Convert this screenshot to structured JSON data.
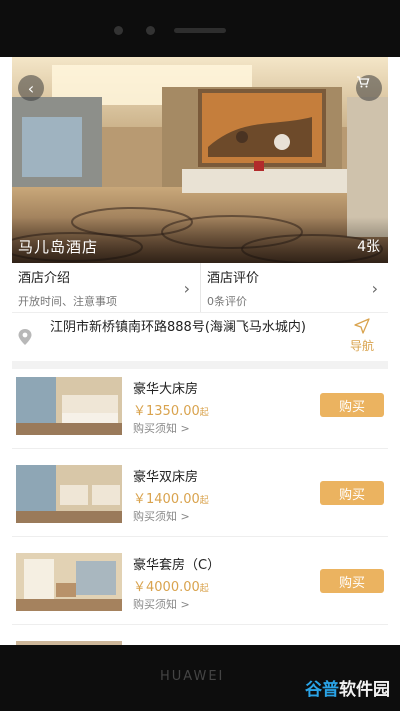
{
  "hotel": {
    "name": "马儿岛酒店",
    "photo_count": "4张"
  },
  "info": {
    "intro_title": "酒店介绍",
    "intro_sub": "开放时间、注意事项",
    "review_title": "酒店评价",
    "review_sub": "0条评价"
  },
  "address": {
    "text": "江阴市新桥镇南环路888号(海澜飞马水城内)",
    "nav_label": "导航"
  },
  "rooms": [
    {
      "name": "豪华大床房",
      "price": "￥1350.00",
      "suffix": "起",
      "note": "购买须知 >",
      "buy_label": "购买"
    },
    {
      "name": "豪华双床房",
      "price": "￥1400.00",
      "suffix": "起",
      "note": "购买须知 >",
      "buy_label": "购买"
    },
    {
      "name": "豪华套房（C）",
      "price": "￥4000.00",
      "suffix": "起",
      "note": "购买须知 >",
      "buy_label": "购买"
    }
  ],
  "device": {
    "brand": "HUAWEI"
  },
  "watermark": {
    "part1": "谷普",
    "part2": "软件园"
  },
  "icons": {
    "back": "chevron-left-icon",
    "cart": "cart-icon",
    "pin": "location-pin-icon",
    "nav": "navigation-arrow-icon",
    "arrow": "chevron-right-icon"
  },
  "colors": {
    "accent": "#ebb360",
    "price": "#d9a34e",
    "frame": "#0d0d0d"
  }
}
